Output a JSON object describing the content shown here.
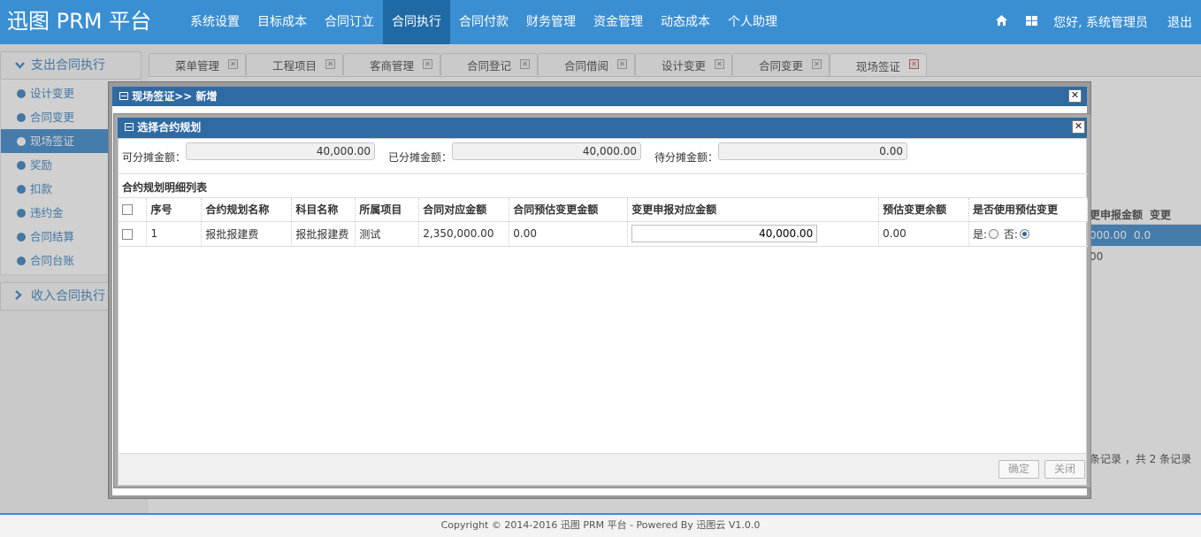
{
  "header": {
    "brand": "迅图 PRM 平台",
    "nav": [
      "系统设置",
      "目标成本",
      "合同订立",
      "合同执行",
      "合同付款",
      "财务管理",
      "资金管理",
      "动态成本",
      "个人助理"
    ],
    "greeting": "您好, 系统管理员",
    "logout": "退出",
    "icons": [
      "home-icon",
      "grid-icon"
    ]
  },
  "sidebar": {
    "group1": "支出合同执行",
    "items": [
      "设计变更",
      "合同变更",
      "现场签证",
      "奖励",
      "扣款",
      "违约金",
      "合同结算",
      "合同台账"
    ],
    "active_item": "现场签证",
    "group2": "收入合同执行"
  },
  "tabs": [
    {
      "label": "菜单管理"
    },
    {
      "label": "工程项目"
    },
    {
      "label": "客商管理"
    },
    {
      "label": "合同登记"
    },
    {
      "label": "合同借阅"
    },
    {
      "label": "设计变更"
    },
    {
      "label": "合同变更"
    },
    {
      "label": "现场签证"
    }
  ],
  "background_grid": {
    "col1": "更申报金额",
    "col2": "变更",
    "row1_val": "000.00",
    "row1_val2": "0.0",
    "row2_val": "00",
    "pagination": "条记录 ，共 2 条记录"
  },
  "outer_modal": {
    "title": "现场签证>> 新增"
  },
  "inner_modal": {
    "title": "选择合约规划",
    "available_label": "可分摊金额：",
    "available_value": "40,000.00",
    "allocated_label": "已分摊金额：",
    "allocated_value": "40,000.00",
    "pending_label": "待分摊金额：",
    "pending_value": "0.00",
    "grid_title": "合约规划明细列表",
    "columns": [
      "序号",
      "合约规划名称",
      "科目名称",
      "所属项目",
      "合同对应金额",
      "合同预估变更金额",
      "变更申报对应金额",
      "预估变更余额",
      "是否使用预估变更"
    ],
    "rows": [
      {
        "no": "1",
        "plan_name": "报批报建费",
        "subject": "报批报建费",
        "project": "测试",
        "contract_amount": "2,350,000.00",
        "est_change": "0.00",
        "declared_amount": "40,000.00",
        "est_balance": "0.00",
        "yes_label": "是:",
        "no_label": "否:",
        "use_estimate": "no"
      }
    ],
    "confirm": "确定",
    "close": "关闭"
  },
  "footer": "Copyright © 2014-2016 迅图 PRM 平台 - Powered By 迅图云 V1.0.0"
}
